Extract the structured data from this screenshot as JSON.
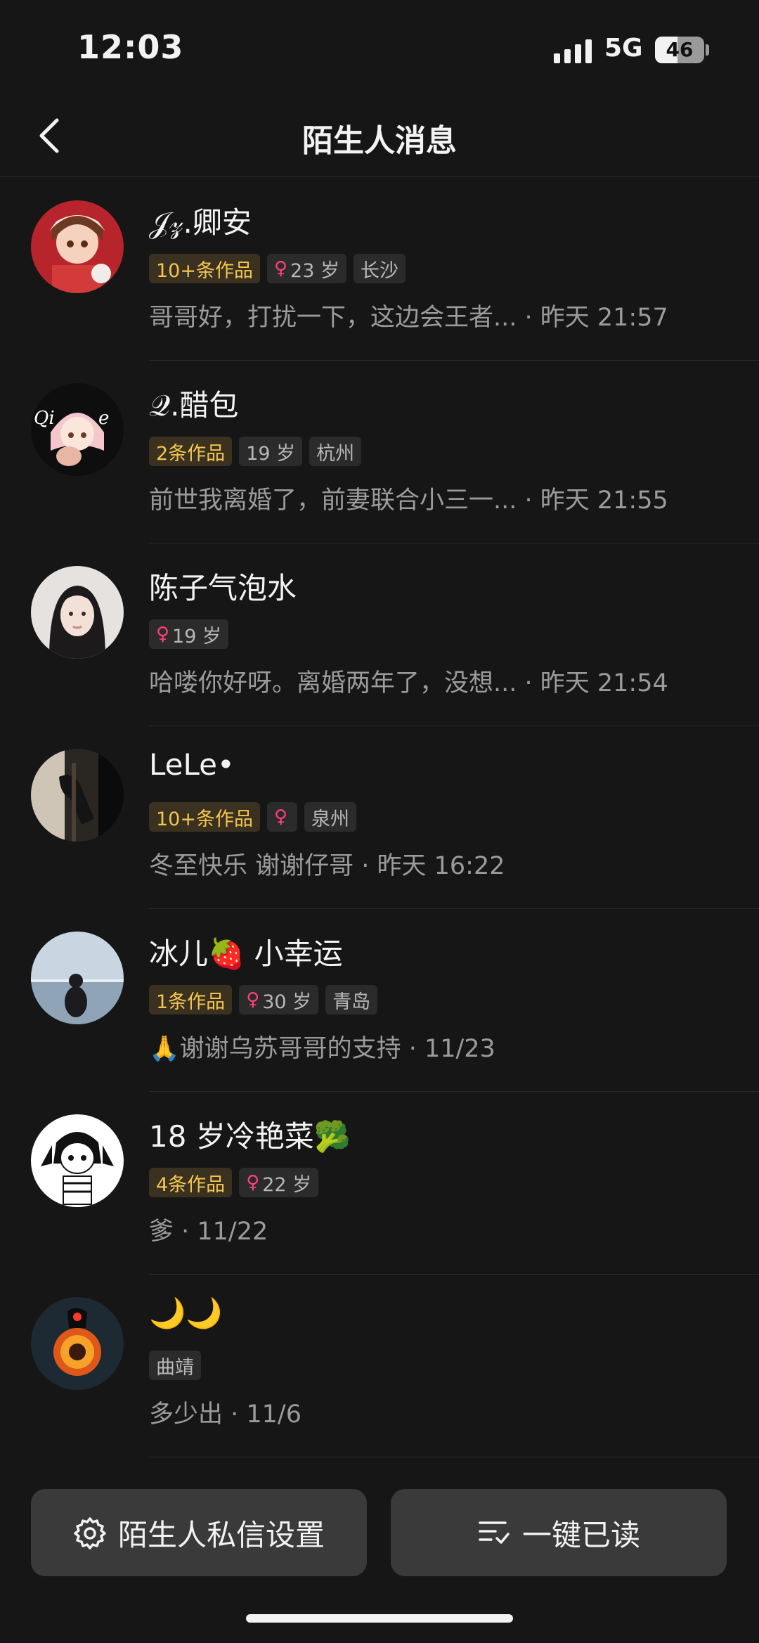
{
  "status_bar": {
    "time": "12:03",
    "network": "5G",
    "battery": "46",
    "battery_level": 0.46
  },
  "header": {
    "title": "陌生人消息"
  },
  "messages": [
    {
      "name": "𝒥𝓏.卿安",
      "tags": [
        {
          "type": "works",
          "text": "10+条作品"
        },
        {
          "type": "age",
          "female": true,
          "text": "23 岁"
        },
        {
          "type": "city",
          "text": "长沙"
        }
      ],
      "preview": "哥哥好，打扰一下，这边会王者... · 昨天 21:57",
      "avatar": "anime-girl-red-avatar"
    },
    {
      "name": "𝒬.醋包",
      "tags": [
        {
          "type": "works",
          "text": "2条作品"
        },
        {
          "type": "age",
          "female": false,
          "text": "19 岁"
        },
        {
          "type": "city",
          "text": "杭州"
        }
      ],
      "preview": "前世我离婚了，前妻联合小三一... · 昨天 21:55",
      "avatar": "anime-pink-girl-avatar"
    },
    {
      "name": "陈子气泡水",
      "tags": [
        {
          "type": "age",
          "female": true,
          "text": "19 岁"
        }
      ],
      "preview": "哈喽你好呀。离婚两年了，没想... · 昨天 21:54",
      "avatar": "girl-portrait-avatar"
    },
    {
      "name": "LeLe•",
      "tags": [
        {
          "type": "works",
          "text": "10+条作品"
        },
        {
          "type": "age",
          "female": true,
          "text": ""
        },
        {
          "type": "city",
          "text": "泉州"
        }
      ],
      "preview": "冬至快乐 谢谢仔哥 · 昨天 16:22",
      "avatar": "dark-room-avatar"
    },
    {
      "name": "冰儿🍓 小幸运",
      "tags": [
        {
          "type": "works",
          "text": "1条作品"
        },
        {
          "type": "age",
          "female": true,
          "text": "30 岁"
        },
        {
          "type": "city",
          "text": "青岛"
        }
      ],
      "preview": "🙏谢谢乌苏哥哥的支持 · 11/23",
      "avatar": "seaside-silhouette-avatar"
    },
    {
      "name": "18 岁冷艳菜🥦",
      "tags": [
        {
          "type": "works",
          "text": "4条作品"
        },
        {
          "type": "age",
          "female": true,
          "text": "22 岁"
        }
      ],
      "preview": "爹 · 11/22",
      "avatar": "cartoon-girl-avatar"
    },
    {
      "name": "🌙🌙",
      "tags": [
        {
          "type": "city",
          "text": "曲靖"
        }
      ],
      "preview": "多少出 · 11/6",
      "avatar": "fire-wheel-avatar"
    }
  ],
  "actions": {
    "settings_label": "陌生人私信设置",
    "mark_read_label": "一键已读"
  },
  "colors": {
    "background": "#161616",
    "works_tag_text": "#f4c64f",
    "female_symbol": "#ff3f78",
    "button_bg": "#3a3a3a"
  }
}
